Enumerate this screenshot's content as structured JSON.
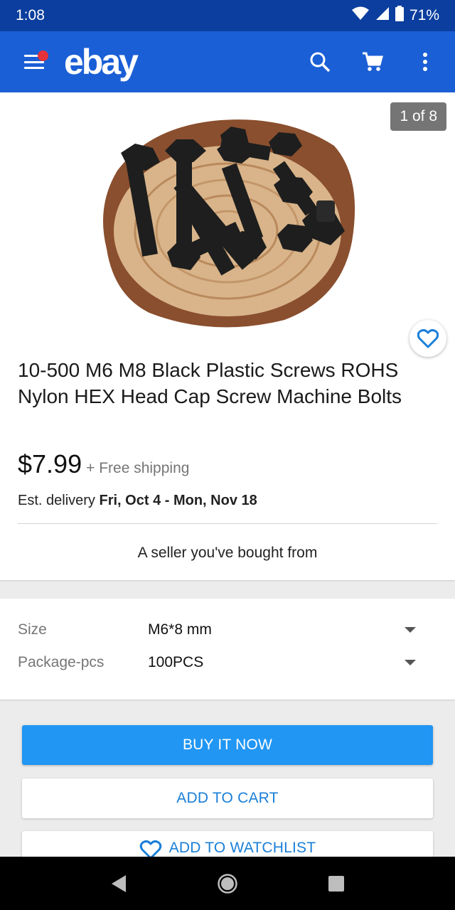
{
  "status_bar": {
    "time": "1:08",
    "battery": "71%"
  },
  "app_bar": {
    "logo": "ebay"
  },
  "product": {
    "image_counter": "1 of 8",
    "title": "10-500 M6 M8 Black Plastic Screws ROHS Nylon HEX Head Cap Screw Machine Bolts",
    "price": "$7.99",
    "shipping": "+ Free shipping",
    "delivery_prefix": "Est. delivery",
    "delivery_dates": "Fri, Oct 4 - Mon, Nov 18",
    "seller_note": "A seller you've bought from"
  },
  "variations": [
    {
      "label": "Size",
      "value": "M6*8 mm"
    },
    {
      "label": "Package-pcs",
      "value": "100PCS"
    }
  ],
  "actions": {
    "buy_now": "BUY IT NOW",
    "add_to_cart": "ADD TO CART",
    "add_to_watchlist": "ADD TO WATCHLIST"
  },
  "colors": {
    "status_bar": "#0b3e9e",
    "app_bar": "#1b5fd6",
    "primary_button": "#2196f3",
    "link_blue": "#1a7fd8",
    "notification_dot": "#e53238"
  },
  "icons": [
    "menu-icon",
    "search-icon",
    "cart-icon",
    "more-vert-icon",
    "heart-icon",
    "back-icon",
    "home-icon",
    "recents-icon",
    "wifi-icon",
    "signal-icon",
    "battery-icon"
  ]
}
